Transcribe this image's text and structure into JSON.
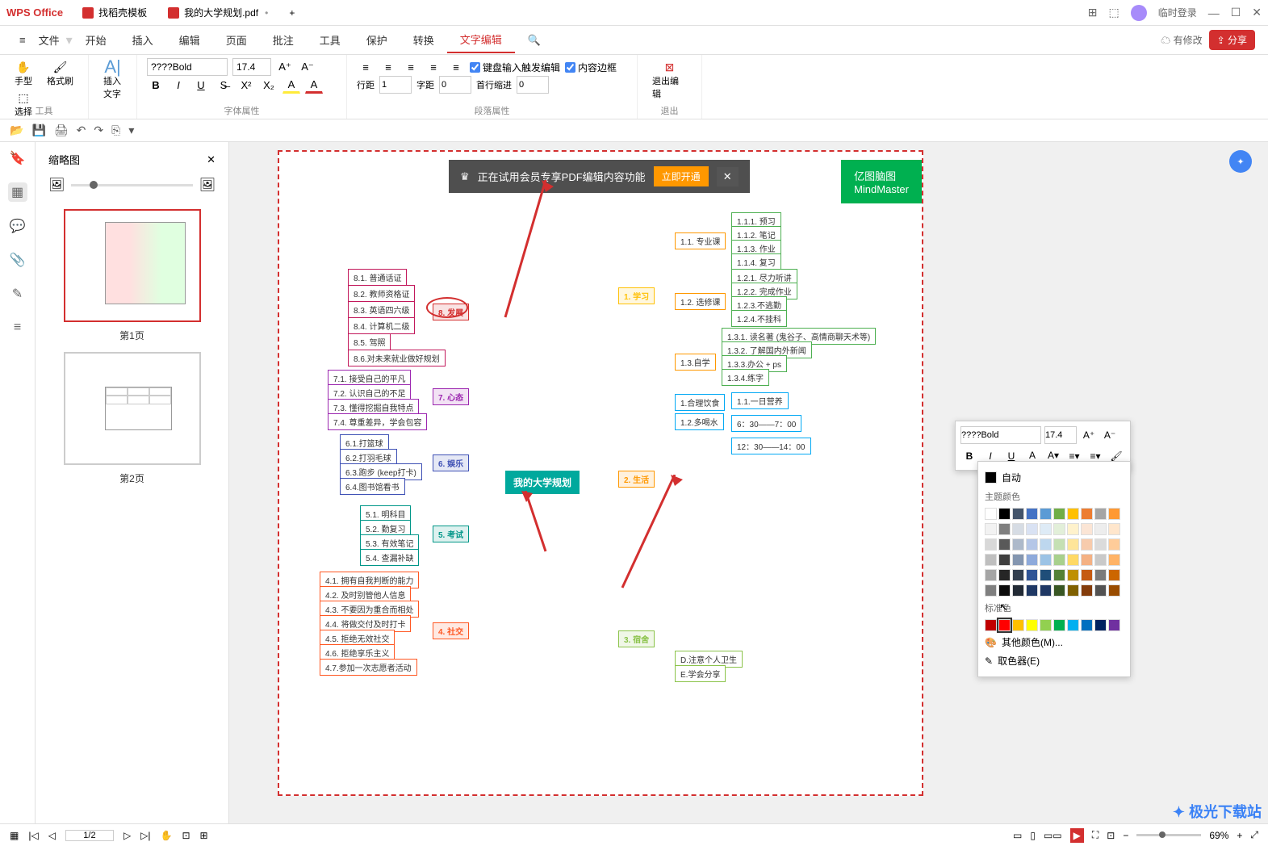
{
  "app": {
    "name": "WPS Office"
  },
  "tabs": [
    {
      "label": "找稻壳模板",
      "icon": "red"
    },
    {
      "label": "我的大学规划.pdf",
      "icon": "red",
      "active": true
    }
  ],
  "login": "临时登录",
  "menu": {
    "file": "文件",
    "items": [
      "开始",
      "插入",
      "编辑",
      "页面",
      "批注",
      "工具",
      "保护",
      "转换",
      "文字编辑"
    ],
    "active": "文字编辑",
    "has_changes": "有修改",
    "share": "分享"
  },
  "ribbon": {
    "tools": {
      "hand": "手型",
      "select": "选择",
      "brush": "格式刷",
      "label": "工具"
    },
    "insert_text": "插入文字",
    "font": {
      "name": "????Bold",
      "size": "17.4",
      "label": "字体属性"
    },
    "para": {
      "line_lbl": "行距",
      "line_val": "1",
      "char_lbl": "字距",
      "char_val": "0",
      "indent_lbl": "首行缩进",
      "indent_val": "0",
      "kb_edit": "键盘输入触发编辑",
      "border": "内容边框",
      "label": "段落属性"
    },
    "exit": {
      "btn": "退出编辑",
      "label": "退出"
    }
  },
  "thumbs": {
    "title": "缩略图",
    "pages": [
      "第1页",
      "第2页"
    ]
  },
  "banner": {
    "text": "正在试用会员专享PDF编辑内容功能",
    "action": "立即开通"
  },
  "mindmaster": {
    "title": "亿图脑图",
    "sub": "MindMaster"
  },
  "center": "我的大学规划",
  "branches": {
    "b8": {
      "title": "8. 发展",
      "items": [
        "8.1. 普通话证",
        "8.2. 教师资格证",
        "8.3. 英语四六级",
        "8.4. 计算机二级",
        "8.5. 驾照",
        "8.6.对未来就业做好规划"
      ]
    },
    "b7": {
      "title": "7. 心态",
      "items": [
        "7.1. 接受自己的平凡",
        "7.2. 认识自己的不足",
        "7.3. 懂得挖掘自我特点",
        "7.4. 尊重差异，学会包容"
      ]
    },
    "b6": {
      "title": "6. 娱乐",
      "items": [
        "6.1.打篮球",
        "6.2.打羽毛球",
        "6.3.跑步 (keep打卡)",
        "6.4.图书馆看书"
      ]
    },
    "b5": {
      "title": "5. 考试",
      "items": [
        "5.1. 明科目",
        "5.2. 勤复习",
        "5.3. 有效笔记",
        "5.4. 查漏补缺"
      ]
    },
    "b4": {
      "title": "4. 社交",
      "items": [
        "4.1. 拥有自我判断的能力",
        "4.2. 及时别管他人信息",
        "4.3. 不要因为重合而相处",
        "4.4. 将做交付及时打卡",
        "4.5. 拒绝无效社交",
        "4.6. 拒绝享乐主义",
        "4.7.参加一次志愿者活动"
      ]
    },
    "b1": {
      "title": "1. 学习",
      "subs": [
        "1.1. 专业课",
        "1.2. 选修课",
        "1.3.自学"
      ],
      "leaf11": [
        "1.1.1. 预习",
        "1.1.2. 笔记",
        "1.1.3. 作业",
        "1.1.4. 复习"
      ],
      "leaf12": [
        "1.2.1. 尽力听讲",
        "1.2.2. 完成作业",
        "1.2.3.不逃勤",
        "1.2.4.不挂科"
      ],
      "leaf13": [
        "1.3.1. 读名著 (鬼谷子、高情商聊天术等)",
        "1.3.2. 了解国内外新闻",
        "1.3.3.办公 + ps",
        "1.3.4.练字"
      ]
    },
    "b2": {
      "title": "2. 生活",
      "subs": [
        "1.合理饮食",
        "1.2.多喝水"
      ],
      "leaf": [
        "1.1.一日营养",
        "6：30——7：00",
        "12：30——14：00"
      ]
    },
    "b3": {
      "title": "3. 宿舍",
      "subs": [
        "D.注意个人卫生",
        "E.学会分享"
      ]
    }
  },
  "float": {
    "font": "????Bold",
    "size": "17.4"
  },
  "colorpanel": {
    "auto": "自动",
    "theme": "主题颜色",
    "std": "标准色",
    "more": "其他颜色(M)...",
    "picker": "取色器(E)",
    "theme_colors": [
      "#ffffff",
      "#000000",
      "#44546a",
      "#4472c4",
      "#5b9bd5",
      "#70ad47",
      "#ffc000",
      "#ed7d31",
      "#a5a5a5",
      "#ff9933"
    ],
    "theme_tints": [
      [
        "#f2f2f2",
        "#7f7f7f",
        "#d6dce4",
        "#d9e2f3",
        "#deebf6",
        "#e2efd9",
        "#fff2cc",
        "#fbe5d5",
        "#ededed",
        "#ffe6cc"
      ],
      [
        "#d8d8d8",
        "#595959",
        "#adb9ca",
        "#b4c6e7",
        "#bdd7ee",
        "#c5e0b3",
        "#fee599",
        "#f7cbac",
        "#dbdbdb",
        "#ffcc99"
      ],
      [
        "#bfbfbf",
        "#3f3f3f",
        "#8496b0",
        "#8eaadb",
        "#9cc3e5",
        "#a8d08d",
        "#ffd965",
        "#f4b183",
        "#c9c9c9",
        "#ffb366"
      ],
      [
        "#a5a5a5",
        "#262626",
        "#323f4f",
        "#2f5496",
        "#1f4e79",
        "#538135",
        "#bf9000",
        "#c55a11",
        "#7b7b7b",
        "#cc6600"
      ],
      [
        "#7f7f7f",
        "#0c0c0c",
        "#222a35",
        "#1f3864",
        "#1f3864",
        "#385623",
        "#7f6000",
        "#833c0b",
        "#525252",
        "#994c00"
      ]
    ],
    "std_colors": [
      "#c00000",
      "#ff0000",
      "#ffc000",
      "#ffff00",
      "#92d050",
      "#00b050",
      "#00b0f0",
      "#0070c0",
      "#002060",
      "#7030a0"
    ]
  },
  "status": {
    "page": "1/2",
    "zoom": "69%"
  },
  "watermark": "极光下载站"
}
